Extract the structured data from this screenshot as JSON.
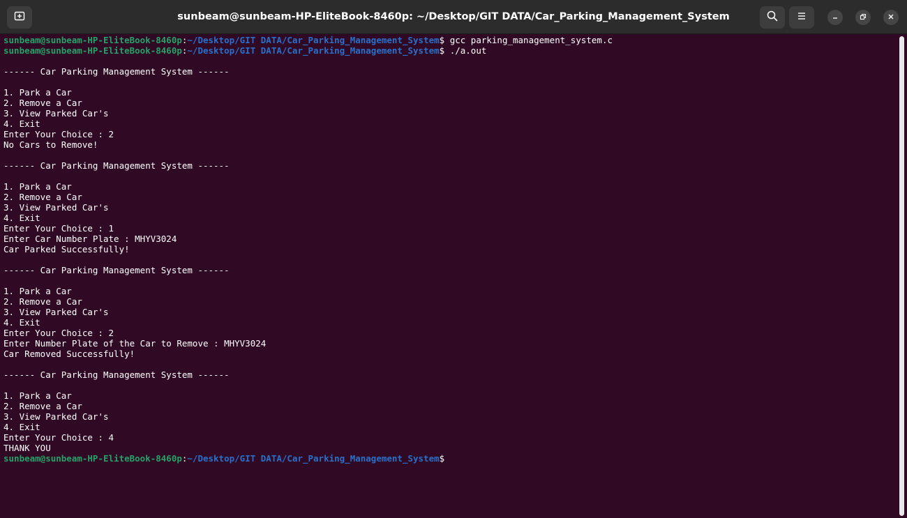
{
  "window": {
    "title": "sunbeam@sunbeam-HP-EliteBook-8460p: ~/Desktop/GIT DATA/Car_Parking_Management_System"
  },
  "icons": {
    "new_tab": "new-tab-icon",
    "search": "search-icon",
    "menu": "hamburger-menu-icon",
    "minimize": "minimize-icon",
    "maximize": "maximize-icon",
    "close": "close-icon"
  },
  "prompt": {
    "user_host": "sunbeam@sunbeam-HP-EliteBook-8460p",
    "path": "~/Desktop/GIT DATA/Car_Parking_Management_System"
  },
  "colors": {
    "background": "#300a24",
    "prompt_user": "#26a269",
    "prompt_path": "#2a6fc9",
    "titlebar": "#2c2c2c"
  },
  "terminal": {
    "lines": [
      {
        "type": "prompt",
        "cmd": " gcc parking_management_system.c"
      },
      {
        "type": "prompt",
        "cmd": " ./a.out"
      },
      {
        "type": "text",
        "text": ""
      },
      {
        "type": "text",
        "text": "------ Car Parking Management System ------"
      },
      {
        "type": "text",
        "text": ""
      },
      {
        "type": "text",
        "text": "1. Park a Car"
      },
      {
        "type": "text",
        "text": "2. Remove a Car"
      },
      {
        "type": "text",
        "text": "3. View Parked Car's"
      },
      {
        "type": "text",
        "text": "4. Exit"
      },
      {
        "type": "text",
        "text": "Enter Your Choice : 2"
      },
      {
        "type": "text",
        "text": "No Cars to Remove!"
      },
      {
        "type": "text",
        "text": ""
      },
      {
        "type": "text",
        "text": "------ Car Parking Management System ------"
      },
      {
        "type": "text",
        "text": ""
      },
      {
        "type": "text",
        "text": "1. Park a Car"
      },
      {
        "type": "text",
        "text": "2. Remove a Car"
      },
      {
        "type": "text",
        "text": "3. View Parked Car's"
      },
      {
        "type": "text",
        "text": "4. Exit"
      },
      {
        "type": "text",
        "text": "Enter Your Choice : 1"
      },
      {
        "type": "text",
        "text": "Enter Car Number Plate : MHYV3024"
      },
      {
        "type": "text",
        "text": "Car Parked Successfully!"
      },
      {
        "type": "text",
        "text": ""
      },
      {
        "type": "text",
        "text": "------ Car Parking Management System ------"
      },
      {
        "type": "text",
        "text": ""
      },
      {
        "type": "text",
        "text": "1. Park a Car"
      },
      {
        "type": "text",
        "text": "2. Remove a Car"
      },
      {
        "type": "text",
        "text": "3. View Parked Car's"
      },
      {
        "type": "text",
        "text": "4. Exit"
      },
      {
        "type": "text",
        "text": "Enter Your Choice : 2"
      },
      {
        "type": "text",
        "text": "Enter Number Plate of the Car to Remove : MHYV3024"
      },
      {
        "type": "text",
        "text": "Car Removed Successfully!"
      },
      {
        "type": "text",
        "text": ""
      },
      {
        "type": "text",
        "text": "------ Car Parking Management System ------"
      },
      {
        "type": "text",
        "text": ""
      },
      {
        "type": "text",
        "text": "1. Park a Car"
      },
      {
        "type": "text",
        "text": "2. Remove a Car"
      },
      {
        "type": "text",
        "text": "3. View Parked Car's"
      },
      {
        "type": "text",
        "text": "4. Exit"
      },
      {
        "type": "text",
        "text": "Enter Your Choice : 4"
      },
      {
        "type": "text",
        "text": "THANK YOU"
      },
      {
        "type": "prompt",
        "cmd": ""
      }
    ]
  }
}
